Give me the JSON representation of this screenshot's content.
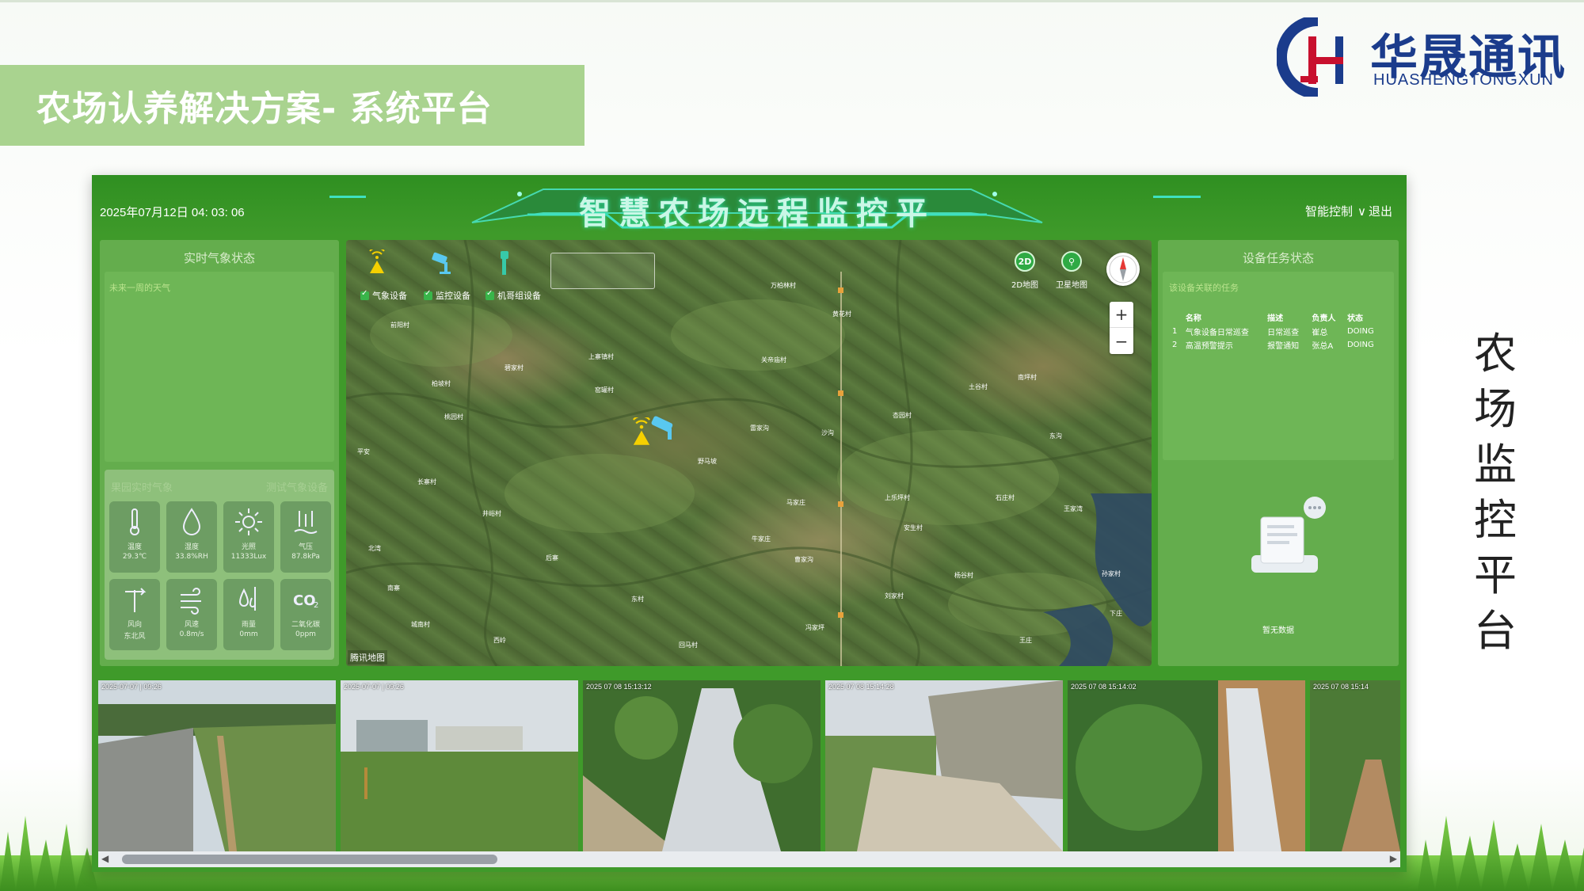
{
  "slide": {
    "title": "农场认养解决方案- 系统平台",
    "side_text": [
      "农",
      "场",
      "监",
      "控",
      "平",
      "台"
    ],
    "logo": {
      "cn": "华晟通讯",
      "en": "HUASHENGTONGXUN"
    },
    "colors": {
      "title_bg": "#a9d38f",
      "brand_blue": "#1b3c8c",
      "brand_red": "#c8102e"
    }
  },
  "platform": {
    "datetime": "2025年07月12日 04: 03: 06",
    "title": "智慧农场远程监控平台",
    "control_menu": "智能控制",
    "logout": "退出",
    "colors": {
      "bg": "#3f9a2a",
      "panel": "#64ad4d",
      "title_glow": "#2fe0b0"
    }
  },
  "left_panel": {
    "title": "实时气象状态",
    "weather_subtitle": "未来一周的天气",
    "realtime_title": "果园实时气象",
    "realtime_device": "测试气象设备",
    "sensors": [
      {
        "icon": "thermometer-icon",
        "name": "温度",
        "value": "29.3℃"
      },
      {
        "icon": "humidity-drop-icon",
        "name": "湿度",
        "value": "33.8%RH"
      },
      {
        "icon": "sun-icon",
        "name": "光照",
        "value": "11333Lux"
      },
      {
        "icon": "pressure-icon",
        "name": "气压",
        "value": "87.8kPa"
      },
      {
        "icon": "wind-vane-icon",
        "name": "风向",
        "value": "东北风"
      },
      {
        "icon": "wind-icon",
        "name": "风速",
        "value": "0.8m/s"
      },
      {
        "icon": "rain-icon",
        "name": "雨量",
        "value": "0mm"
      },
      {
        "icon": "co2-icon",
        "name": "二氧化碳",
        "value": "0ppm"
      }
    ]
  },
  "map": {
    "legend": [
      {
        "icon": "weather-station-icon",
        "label": "气象设备"
      },
      {
        "icon": "camera-icon",
        "label": "监控设备"
      },
      {
        "icon": "insect-trap-icon",
        "label": "机哥组设备"
      }
    ],
    "mode_2d": "2D",
    "mode_2d_label": "2D地图",
    "mode_sat_label": "卫星地图",
    "zoom_in": "+",
    "zoom_out": "−",
    "copyright": "腾讯地图",
    "places": [
      "万柏林村",
      "黄花村",
      "前阳村",
      "上寨镇村",
      "碧家村",
      "柏坡村",
      "关帝庙村",
      "窑罐村",
      "土谷村",
      "南坪村",
      "杏园村",
      "桃园村",
      "雷家沟",
      "沙沟",
      "野马坡",
      "东沟",
      "长寨村",
      "平安",
      "马家庄",
      "上乐坪村",
      "石庄村",
      "井峪村",
      "牛家庄",
      "王家湾",
      "安生村",
      "北湾",
      "后寨",
      "曹家沟",
      "孙家村",
      "杨谷村",
      "南寨",
      "东村",
      "刘家村",
      "下庄",
      "城南村",
      "冯家坪",
      "回马村",
      "王庄",
      "西岭"
    ]
  },
  "right_panel": {
    "title": "设备任务状态",
    "subtitle": "该设备关联的任务",
    "columns": [
      "名称",
      "描述",
      "负责人",
      "状态"
    ],
    "rows": [
      {
        "idx": "1",
        "name": "气象设备日常巡查",
        "desc": "日常巡查",
        "owner": "崔总",
        "status": "DOING"
      },
      {
        "idx": "2",
        "name": "高温预警提示",
        "desc": "报警通知",
        "owner": "张总A",
        "status": "DOING"
      }
    ],
    "empty_text": "暂无数据"
  },
  "cameras": [
    {
      "timestamp": "2025-07-07 | 09:26"
    },
    {
      "timestamp": "2025-07-07 | 09:26"
    },
    {
      "timestamp": "2025 07 08 15:13:12"
    },
    {
      "timestamp": "2025 07 08 15:14:28"
    },
    {
      "timestamp": "2025 07 08 15:14:02"
    },
    {
      "timestamp": "2025 07 08 15:14"
    }
  ],
  "scroll": {
    "left_arrow": "◀",
    "right_arrow": "▶"
  }
}
